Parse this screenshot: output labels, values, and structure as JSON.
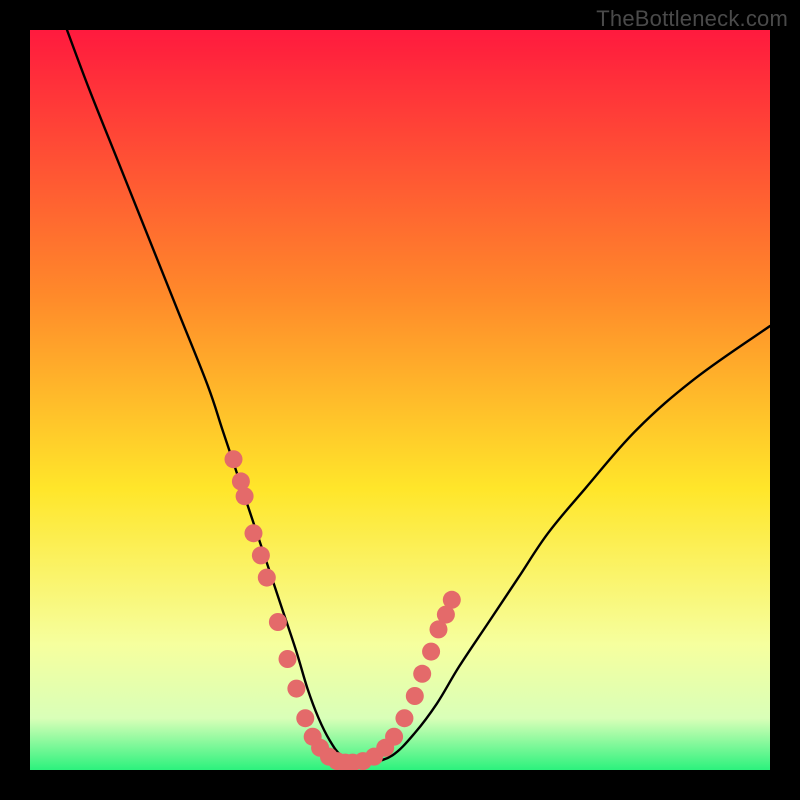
{
  "watermark": "TheBottleneck.com",
  "colors": {
    "frame": "#000000",
    "grad_top": "#ff1a3e",
    "grad_mid1": "#ff8a2a",
    "grad_mid2": "#ffe62a",
    "grad_mid3": "#f6ff9e",
    "grad_bot1": "#d9ffb8",
    "grad_bot2": "#2cf27d",
    "curve": "#000000",
    "dot": "#e46a6a"
  },
  "chart_data": {
    "type": "line",
    "title": "",
    "xlabel": "",
    "ylabel": "",
    "xlim": [
      0,
      100
    ],
    "ylim": [
      0,
      100
    ],
    "series": [
      {
        "name": "bottleneck-curve",
        "x": [
          5,
          8,
          12,
          16,
          20,
          24,
          26,
          28,
          30,
          32,
          34,
          36,
          37.5,
          39,
          40.5,
          42,
          44,
          46,
          49,
          52,
          55,
          58,
          62,
          66,
          70,
          75,
          82,
          90,
          100
        ],
        "y": [
          100,
          92,
          82,
          72,
          62,
          52,
          46,
          40,
          34,
          28,
          22,
          16,
          11,
          7,
          4,
          2,
          1,
          1,
          2,
          5,
          9,
          14,
          20,
          26,
          32,
          38,
          46,
          53,
          60
        ]
      }
    ],
    "highlight_points": {
      "name": "beads",
      "x": [
        27.5,
        28.5,
        29.0,
        30.2,
        31.2,
        32.0,
        33.5,
        34.8,
        36.0,
        37.2,
        38.2,
        39.2,
        40.4,
        41.5,
        42.6,
        43.6,
        45.0,
        46.5,
        48.0,
        49.2,
        50.6,
        52.0,
        53.0,
        54.2,
        55.2,
        56.2,
        57.0
      ],
      "y": [
        42,
        39,
        37,
        32,
        29,
        26,
        20,
        15,
        11,
        7,
        4.5,
        3,
        1.8,
        1.2,
        1.0,
        1.0,
        1.2,
        1.8,
        3.0,
        4.5,
        7,
        10,
        13,
        16,
        19,
        21,
        23
      ]
    }
  }
}
